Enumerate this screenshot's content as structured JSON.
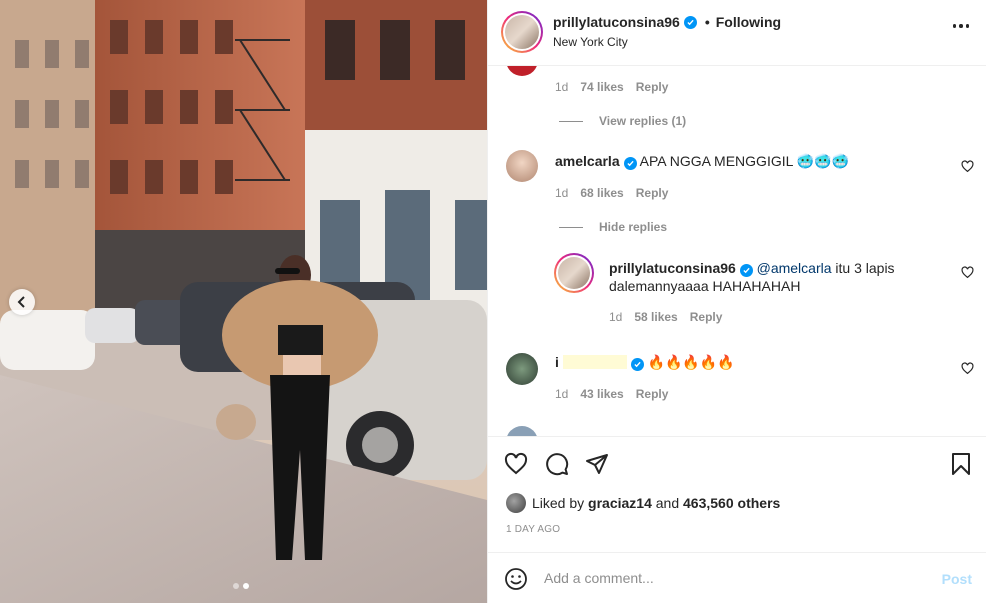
{
  "header": {
    "username": "prillylatuconsina96",
    "follow_status": "Following",
    "separator": "•",
    "location": "New York City"
  },
  "comments": [
    {
      "username": "",
      "text": "",
      "time": "1d",
      "likes": "74 likes",
      "reply": "Reply",
      "replies_toggle": "View replies (1)"
    },
    {
      "username": "amelcarla",
      "text": "APA NGGA MENGGIGIL 🥶🥶🥶",
      "time": "1d",
      "likes": "68 likes",
      "reply": "Reply",
      "replies_toggle": "Hide replies",
      "replies": [
        {
          "username": "prillylatuconsina96",
          "mention": "@amelcarla",
          "text_line1": " itu 3 lapis",
          "text_line2": "dalemannyaaaa HAHAHAHAH",
          "time": "1d",
          "likes": "58 likes",
          "reply": "Reply"
        }
      ]
    },
    {
      "username": "i",
      "text": "🔥🔥🔥🔥🔥",
      "time": "1d",
      "likes": "43 likes",
      "reply": "Reply"
    }
  ],
  "likes_summary": {
    "prefix": "Liked by ",
    "user": "graciaz14",
    "middle": " and ",
    "count": "463,560 others"
  },
  "timestamp": "1 DAY AGO",
  "add_comment": {
    "placeholder": "Add a comment...",
    "post_label": "Post"
  },
  "colors": {
    "verified": "#0095f6",
    "post_disabled": "#b2dffc",
    "secondary_text": "#8e8e8e"
  },
  "icons": [
    "chevron-left-icon",
    "more-options-icon",
    "heart-icon",
    "comment-icon",
    "share-icon",
    "bookmark-icon",
    "emoji-icon",
    "verified-icon"
  ],
  "carousel": {
    "total": 2,
    "active": 2
  }
}
